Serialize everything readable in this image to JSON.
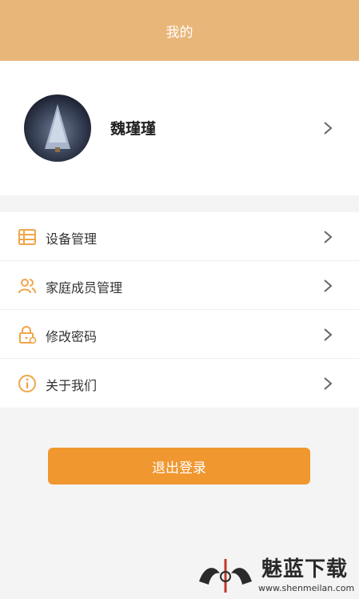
{
  "header": {
    "title": "我的"
  },
  "profile": {
    "name": "魏瑾瑾"
  },
  "menu": {
    "items": [
      {
        "label": "设备管理",
        "icon": "device-list-icon"
      },
      {
        "label": "家庭成员管理",
        "icon": "family-members-icon"
      },
      {
        "label": "修改密码",
        "icon": "lock-icon"
      },
      {
        "label": "关于我们",
        "icon": "info-icon"
      }
    ]
  },
  "logout": {
    "label": "退出登录"
  },
  "watermark": {
    "title": "魅蓝下载",
    "url": "www.shenmeilan.com"
  },
  "colors": {
    "header": "#e9b67a",
    "accent": "#f0972f",
    "icon": "#f0a54a"
  }
}
